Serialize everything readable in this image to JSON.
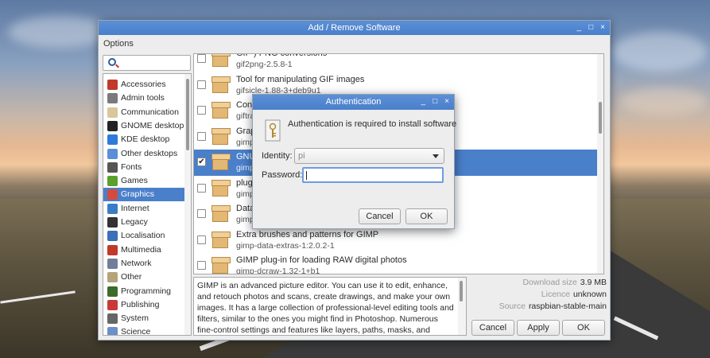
{
  "desktop": {},
  "main_window": {
    "title": "Add / Remove Software",
    "controls": {
      "minimize": "_",
      "maximize": "□",
      "close": "×"
    },
    "menu": {
      "options": "Options"
    },
    "search": {
      "value": "",
      "icon": "search-icon"
    },
    "categories": [
      {
        "label": "Accessories",
        "icon": "accessories-icon",
        "color": "#c0392b"
      },
      {
        "label": "Admin tools",
        "icon": "admin-tools-icon",
        "color": "#7a7a7a"
      },
      {
        "label": "Communication",
        "icon": "communication-icon",
        "color": "#d7c79a"
      },
      {
        "label": "GNOME desktop",
        "icon": "gnome-icon",
        "color": "#222222"
      },
      {
        "label": "KDE desktop",
        "icon": "kde-icon",
        "color": "#2f7ad8"
      },
      {
        "label": "Other desktops",
        "icon": "other-desktops-icon",
        "color": "#5b8ed6"
      },
      {
        "label": "Fonts",
        "icon": "fonts-icon",
        "color": "#555555"
      },
      {
        "label": "Games",
        "icon": "games-icon",
        "color": "#5aa02c"
      },
      {
        "label": "Graphics",
        "icon": "graphics-icon",
        "color": "#d24b3e"
      },
      {
        "label": "Internet",
        "icon": "internet-icon",
        "color": "#3b7dc4"
      },
      {
        "label": "Legacy",
        "icon": "legacy-icon",
        "color": "#333333"
      },
      {
        "label": "Localisation",
        "icon": "localisation-icon",
        "color": "#3b6fb6"
      },
      {
        "label": "Multimedia",
        "icon": "multimedia-icon",
        "color": "#c0392b"
      },
      {
        "label": "Network",
        "icon": "network-icon",
        "color": "#6f7f99"
      },
      {
        "label": "Other",
        "icon": "other-icon",
        "color": "#b5a47a"
      },
      {
        "label": "Programming",
        "icon": "programming-icon",
        "color": "#3d6b2a"
      },
      {
        "label": "Publishing",
        "icon": "publishing-icon",
        "color": "#c83a3a"
      },
      {
        "label": "System",
        "icon": "system-icon",
        "color": "#666666"
      },
      {
        "label": "Science",
        "icon": "science-icon",
        "color": "#6a8fc9"
      }
    ],
    "selected_category": "Graphics",
    "packages": [
      {
        "name": "GIF-) PNG conversions",
        "version": "gif2png-2.5.8-1",
        "checked": false
      },
      {
        "name": "Tool for manipulating GIF images",
        "version": "gifsicle-1.88-3+deb9u1",
        "checked": false
      },
      {
        "name": "Conv",
        "version": "giftra",
        "checked": false
      },
      {
        "name": "Grap",
        "version": "gimp",
        "checked": false
      },
      {
        "name": "GNU",
        "version": "gimp",
        "checked": true
      },
      {
        "name": "plugi",
        "version": "gimp",
        "checked": false
      },
      {
        "name": "Data",
        "version": "gimp",
        "checked": false
      },
      {
        "name": "Extra brushes and patterns for GIMP",
        "version": "gimp-data-extras-1:2.0.2-1",
        "checked": false
      },
      {
        "name": "GIMP plug-in for loading RAW digital photos",
        "version": "gimp-dcraw-1.32-1+b1",
        "checked": false
      }
    ],
    "description": "GIMP is an advanced picture editor. You can use it to edit, enhance, and retouch photos and scans, create drawings, and make your own images. It has a large collection of professional-level editing tools and filters, similar to the ones you might find in Photoshop. Numerous fine-control settings and features like layers, paths, masks, and scripting give you",
    "info": {
      "download_size_label": "Download size",
      "download_size": "3.9 MB",
      "licence_label": "Licence",
      "licence": "unknown",
      "source_label": "Source",
      "source": "raspbian-stable-main"
    },
    "buttons": {
      "cancel": "Cancel",
      "apply": "Apply",
      "ok": "OK"
    }
  },
  "auth_dialog": {
    "title": "Authentication",
    "controls": {
      "minimize": "_",
      "maximize": "□",
      "close": "×"
    },
    "message": "Authentication is required to install software",
    "identity_label": "Identity:",
    "identity_value": "pi",
    "password_label": "Password:",
    "password_value": "",
    "buttons": {
      "cancel": "Cancel",
      "ok": "OK"
    }
  }
}
